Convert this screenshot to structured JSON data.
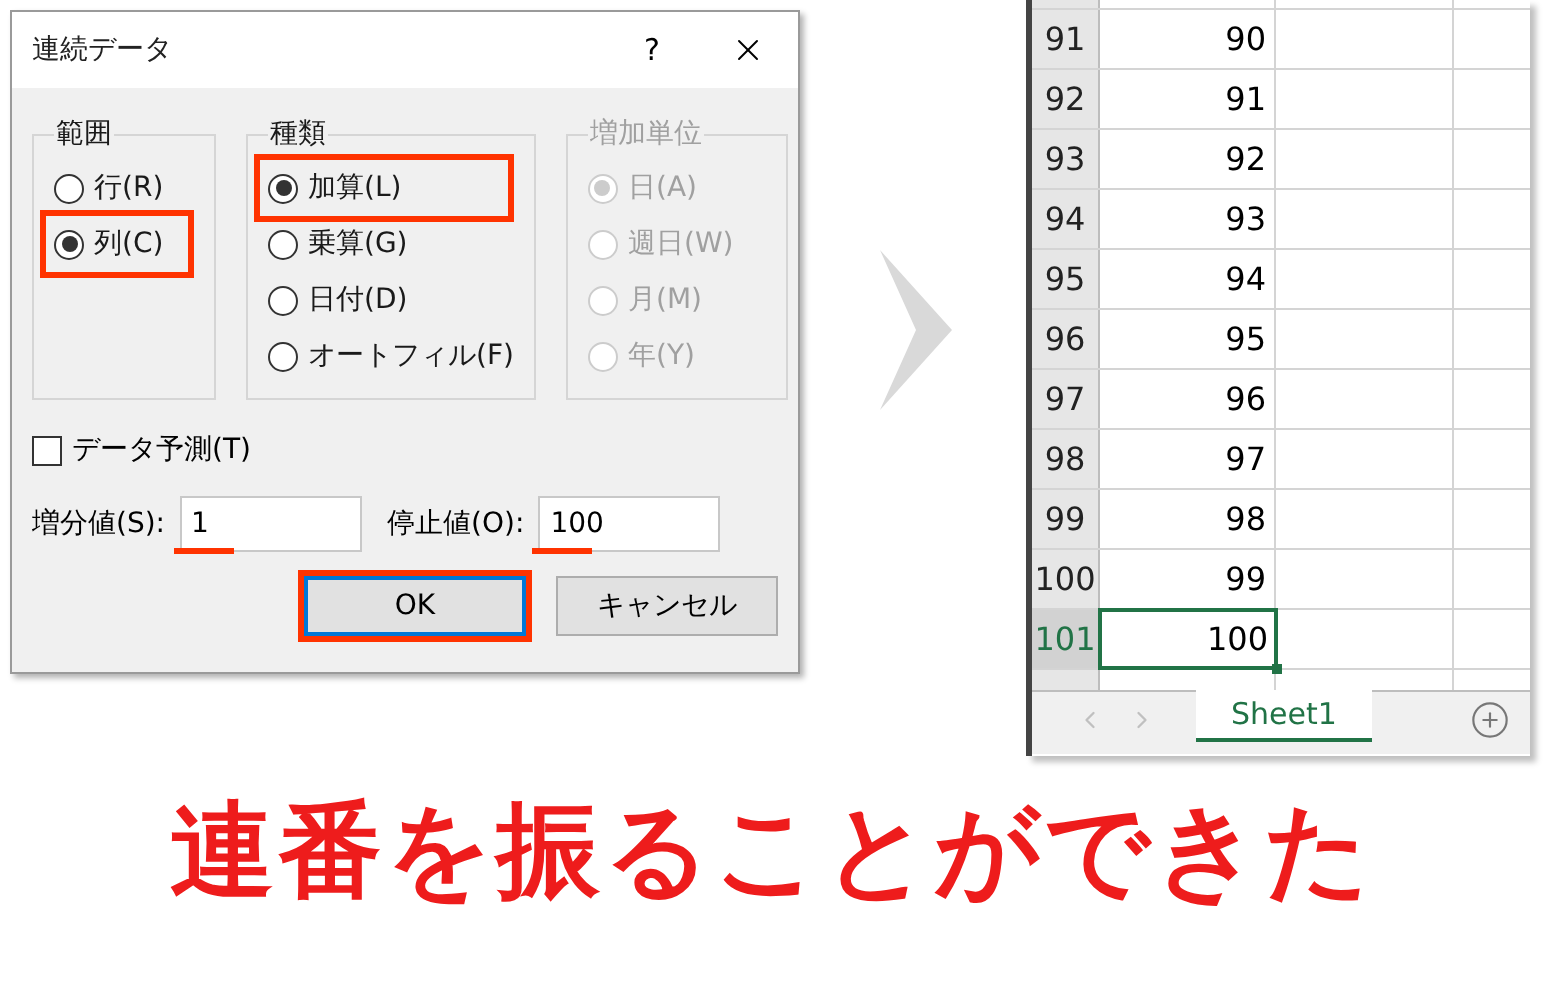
{
  "dialog": {
    "title": "連続データ",
    "help": "?",
    "groups": [
      {
        "label": "範囲",
        "disabled": false,
        "options": [
          {
            "label": "行(R)",
            "selected": false,
            "highlighted": false
          },
          {
            "label": "列(C)",
            "selected": true,
            "highlighted": true
          }
        ]
      },
      {
        "label": "種類",
        "disabled": false,
        "options": [
          {
            "label": "加算(L)",
            "selected": true,
            "highlighted": true
          },
          {
            "label": "乗算(G)",
            "selected": false,
            "highlighted": false
          },
          {
            "label": "日付(D)",
            "selected": false,
            "highlighted": false
          },
          {
            "label": "オートフィル(F)",
            "selected": false,
            "highlighted": false
          }
        ]
      },
      {
        "label": "増加単位",
        "disabled": true,
        "options": [
          {
            "label": "日(A)",
            "selected": true,
            "highlighted": false
          },
          {
            "label": "週日(W)",
            "selected": false,
            "highlighted": false
          },
          {
            "label": "月(M)",
            "selected": false,
            "highlighted": false
          },
          {
            "label": "年(Y)",
            "selected": false,
            "highlighted": false
          }
        ]
      }
    ],
    "checkbox": {
      "label": "データ予測(T)",
      "checked": false
    },
    "fields": [
      {
        "label": "増分値(S):",
        "value": "1",
        "underlined": true
      },
      {
        "label": "停止値(O):",
        "value": "100",
        "underlined": true
      }
    ],
    "buttons": [
      {
        "label": "OK",
        "default": true,
        "highlighted": true
      },
      {
        "label": "キャンセル",
        "default": false,
        "highlighted": false
      }
    ]
  },
  "sheet": {
    "rows": [
      {
        "header": "91",
        "value": "90",
        "selected": false
      },
      {
        "header": "92",
        "value": "91",
        "selected": false
      },
      {
        "header": "93",
        "value": "92",
        "selected": false
      },
      {
        "header": "94",
        "value": "93",
        "selected": false
      },
      {
        "header": "95",
        "value": "94",
        "selected": false
      },
      {
        "header": "96",
        "value": "95",
        "selected": false
      },
      {
        "header": "97",
        "value": "96",
        "selected": false
      },
      {
        "header": "98",
        "value": "97",
        "selected": false
      },
      {
        "header": "99",
        "value": "98",
        "selected": false
      },
      {
        "header": "100",
        "value": "99",
        "selected": false
      },
      {
        "header": "101",
        "value": "100",
        "selected": true
      }
    ],
    "tabs": [
      {
        "label": "Sheet1",
        "selected": true
      }
    ]
  },
  "caption": "連番を振ることができた"
}
